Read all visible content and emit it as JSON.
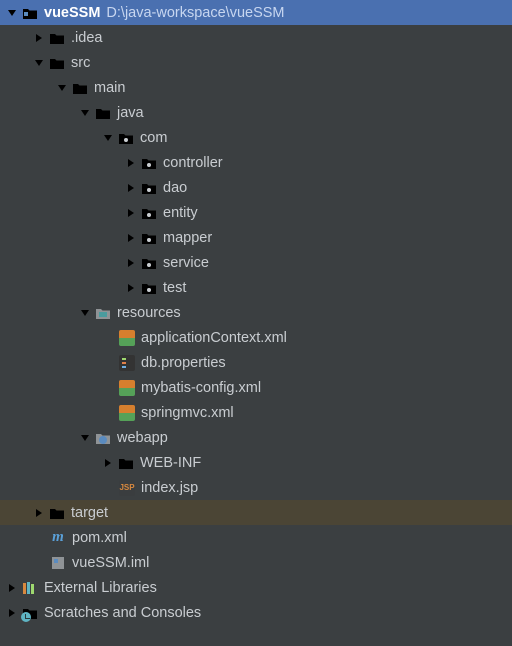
{
  "root": {
    "name": "vueSSM",
    "path": "D:\\java-workspace\\vueSSM"
  },
  "tree": {
    "idea": ".idea",
    "src": "src",
    "main": "main",
    "java": "java",
    "com": "com",
    "controller": "controller",
    "dao": "dao",
    "entity": "entity",
    "mapper": "mapper",
    "service": "service",
    "test": "test",
    "resources": "resources",
    "appctx": "applicationContext.xml",
    "dbprop": "db.properties",
    "mybatis": "mybatis-config.xml",
    "springmvc": "springmvc.xml",
    "webapp": "webapp",
    "webinf": "WEB-INF",
    "indexjsp": "index.jsp",
    "target": "target",
    "pom": "pom.xml",
    "iml": "vueSSM.iml"
  },
  "extlib": "External Libraries",
  "scratches": "Scratches and Consoles",
  "jsp_badge": "JSP",
  "maven_badge": "m"
}
